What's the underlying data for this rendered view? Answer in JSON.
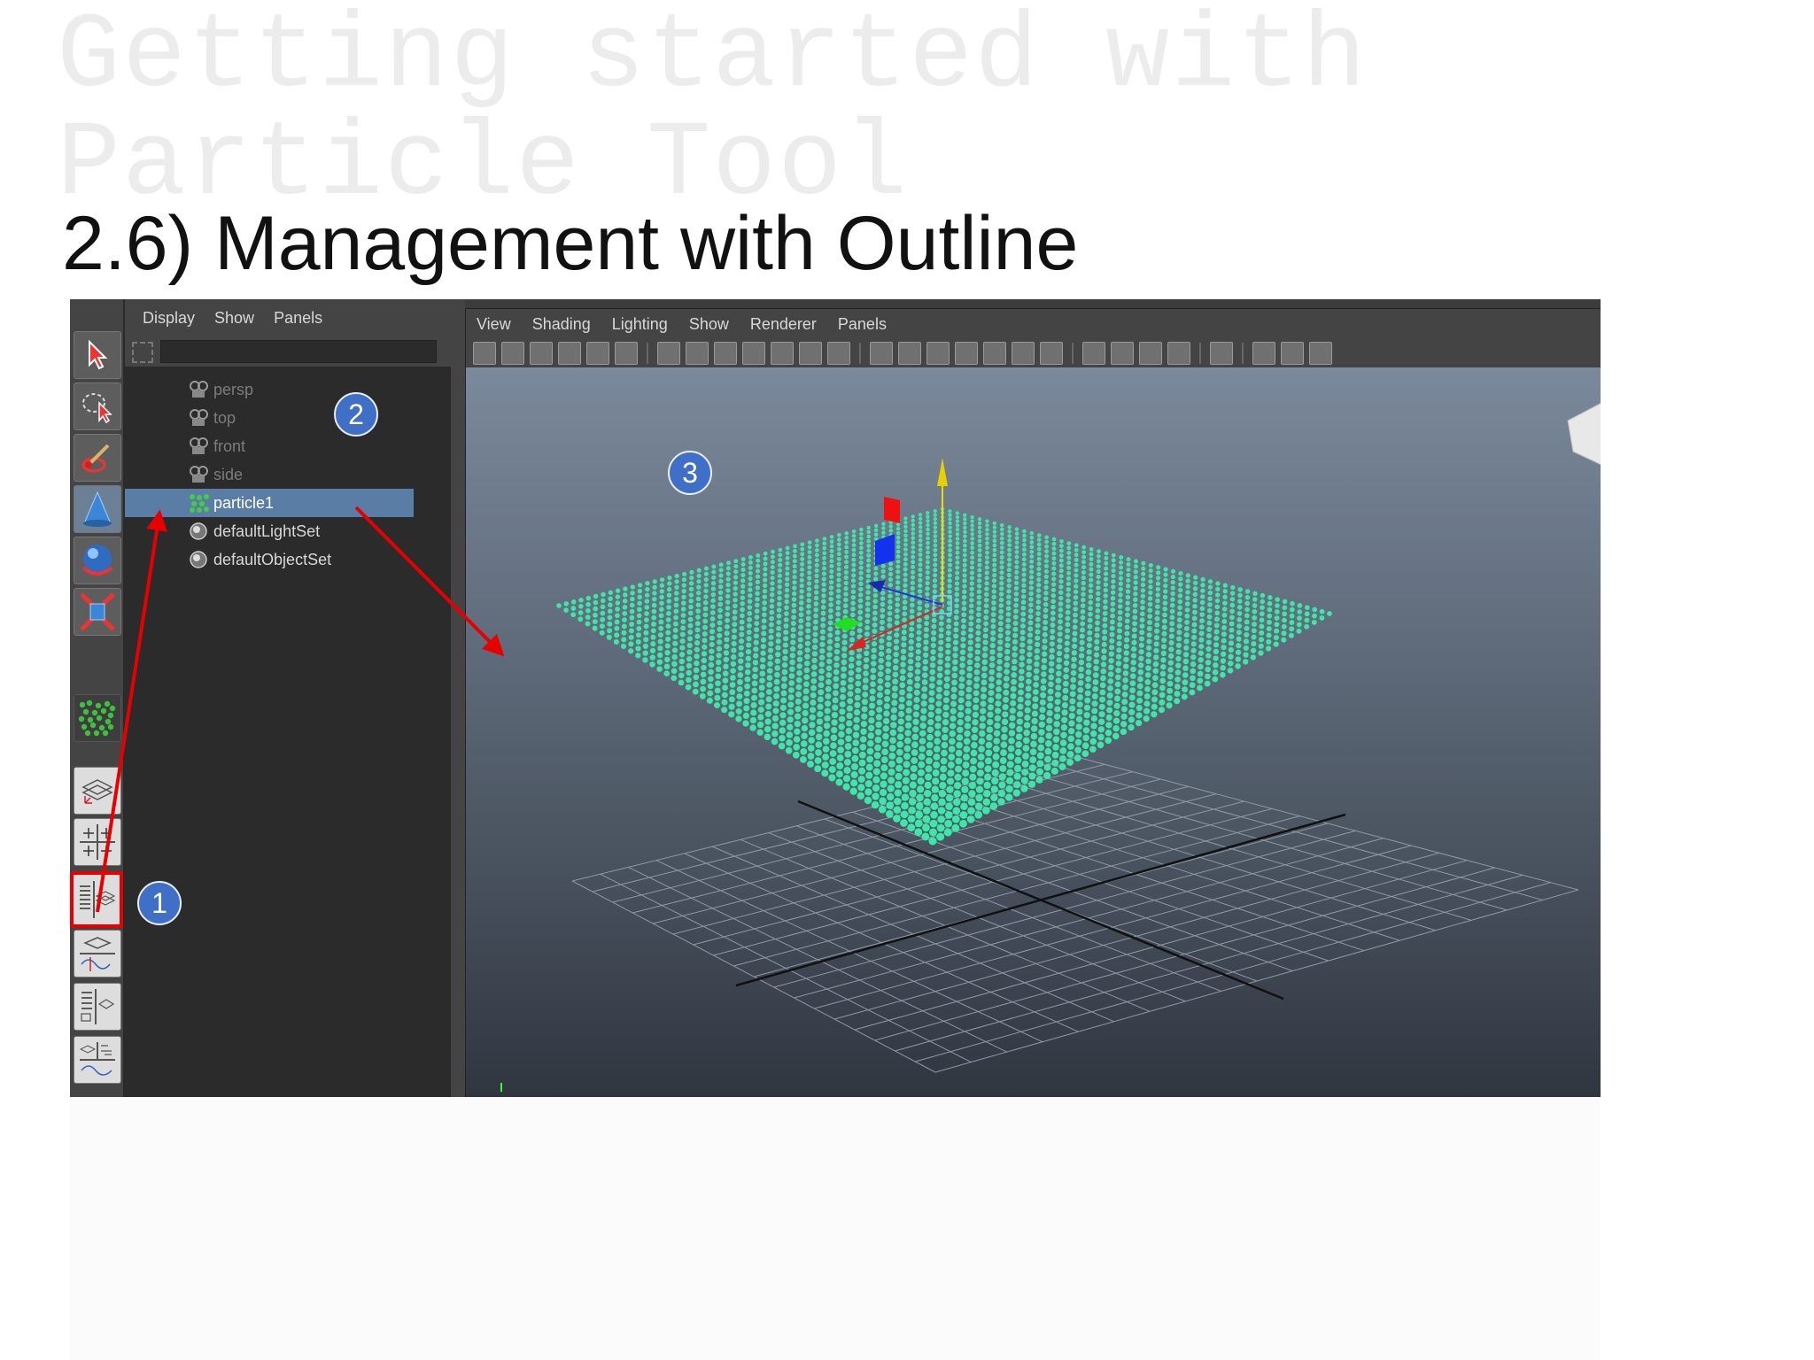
{
  "slide": {
    "title": "Getting started with Particle Tool",
    "subtitle": "2.6) Management with Outline"
  },
  "outliner": {
    "menu": [
      "Display",
      "Show",
      "Panels"
    ],
    "items": [
      {
        "label": "persp",
        "icon": "camera-icon",
        "state": "dim"
      },
      {
        "label": "top",
        "icon": "camera-icon",
        "state": "dim"
      },
      {
        "label": "front",
        "icon": "camera-icon",
        "state": "dim"
      },
      {
        "label": "side",
        "icon": "camera-icon",
        "state": "dim"
      },
      {
        "label": "particle1",
        "icon": "particle-icon",
        "state": "selected"
      },
      {
        "label": "defaultLightSet",
        "icon": "set-icon",
        "state": "normal"
      },
      {
        "label": "defaultObjectSet",
        "icon": "set-icon",
        "state": "normal"
      }
    ]
  },
  "viewport": {
    "menu": [
      "View",
      "Shading",
      "Lighting",
      "Show",
      "Renderer",
      "Panels"
    ],
    "particle_color": "#3ee6a8",
    "background_top": "#7b899c",
    "background_bottom": "#303640"
  },
  "callouts": {
    "one": "1",
    "two": "2",
    "three": "3",
    "color": "#3f6fc7",
    "arrow_color": "#e60000"
  },
  "tools": [
    "select-tool-icon",
    "lasso-tool-icon",
    "paint-tool-icon",
    "move-tool-icon",
    "rotate-tool-icon",
    "scale-tool-icon",
    "particle-tool-icon",
    "single-pane-layout-icon",
    "four-pane-layout-icon",
    "outliner-persp-layout-icon",
    "persp-graph-layout-icon",
    "hypershade-layout-icon",
    "persp-graph-outliner-layout-icon"
  ]
}
